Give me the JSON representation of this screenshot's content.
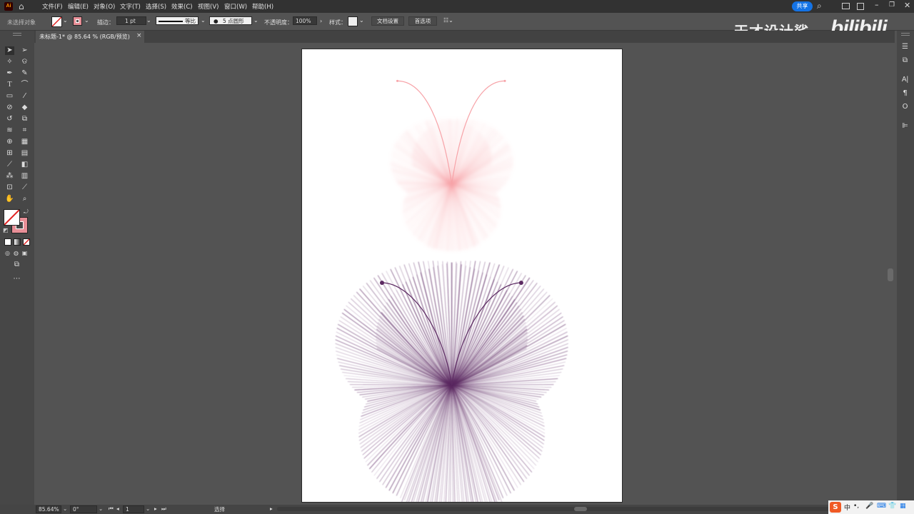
{
  "menubar": {
    "app_icon": "Ai",
    "items": [
      "文件(F)",
      "编辑(E)",
      "对象(O)",
      "文字(T)",
      "选择(S)",
      "效果(C)",
      "视图(V)",
      "窗口(W)",
      "帮助(H)"
    ],
    "share_label": "共享"
  },
  "control": {
    "selection_state": "未选择对象",
    "stroke_label": "描边：",
    "stroke_weight": "1 pt",
    "stroke_profile": "等比",
    "brush": "5 点圆形",
    "opacity_label": "不透明度：",
    "opacity_value": "100%",
    "style_label": "样式：",
    "doc_setup": "文档设置",
    "preferences": "首选项"
  },
  "document": {
    "tab_title": "未标题-1* @ 85.64 % (RGB/预览)",
    "close": "×"
  },
  "status": {
    "zoom": "85.64%",
    "rotation": "0°",
    "artboard": "1",
    "tool": "选择"
  },
  "watermark": {
    "text": "天才设计鲨",
    "logo": "bilibili"
  },
  "colors": {
    "pink_butterfly": "#f7a3a8",
    "purple_butterfly": "#5c2a62",
    "accent": "#1473e6"
  }
}
